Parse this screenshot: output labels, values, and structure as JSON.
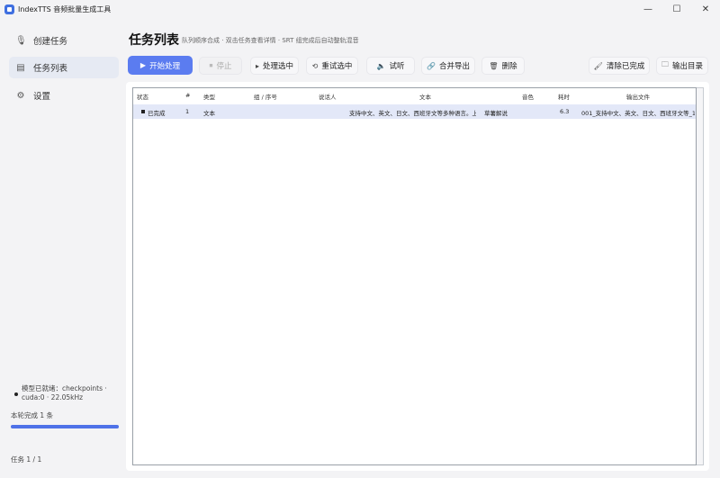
{
  "window": {
    "title": "IndexTTS 音频批量生成工具",
    "controls": {
      "minimize": "—",
      "maximize": "☐",
      "close": "✕"
    }
  },
  "sidebar": {
    "items": [
      {
        "label": "创建任务",
        "icon": "microphone-icon",
        "active": false
      },
      {
        "label": "任务列表",
        "icon": "list-icon",
        "active": true
      },
      {
        "label": "设置",
        "icon": "gear-icon",
        "active": false
      }
    ],
    "status": {
      "model_line1": "模型已就绪：checkpoints ·",
      "model_line2": "cuda:0 · 22.05kHz",
      "batch_text": "本轮完成 1 条",
      "progress": 1.0,
      "task_count": "任务 1 / 1"
    }
  },
  "main": {
    "title": "任务列表",
    "subtitle": "队列顺序合成 · 双击任务查看详情 · SRT 组完成后自动整轨混音"
  },
  "toolbar": {
    "start": "开始处理",
    "stop": "停止",
    "process_selected": "处理选中",
    "retry_selected": "重试选中",
    "listen": "试听",
    "merge_export": "合并导出",
    "delete": "删除",
    "clear_done": "清除已完成",
    "output_dir": "输出目录"
  },
  "table": {
    "headers": [
      "状态",
      "#",
      "类型",
      "组 / 序号",
      "说话人",
      "文本",
      "音色",
      "耗时",
      "输出文件"
    ],
    "rows": [
      {
        "status": "已完成",
        "index": "1",
        "type": "文本",
        "group": "",
        "speaker": "",
        "text": "支持中文、英文、日文、西班牙文等多种语言。上传中文参考音频后，将自动识别并进行语言适配和音色克隆。适用于多语种内容制作，欢迎使用！",
        "voice": "草薯解说",
        "duration": "6.3",
        "output": "001_支持中文、英文、日文、西班牙文等_1"
      }
    ]
  },
  "colors": {
    "accent": "#5b7cf0",
    "sidebar_active": "#e6eaf3",
    "selected_row": "#e3e8f8"
  }
}
